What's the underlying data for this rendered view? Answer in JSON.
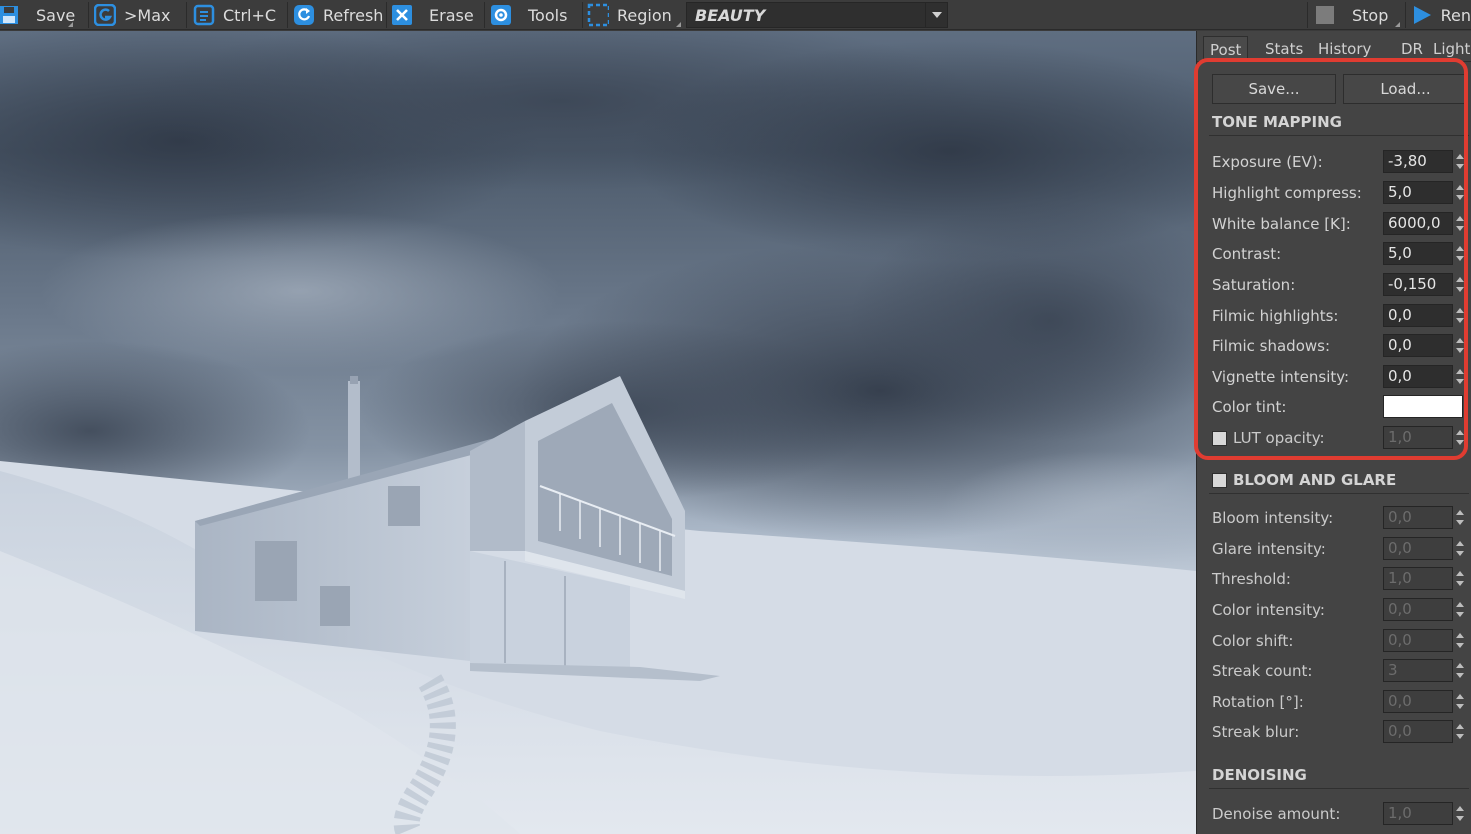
{
  "toolbar": {
    "save_label": "Save",
    "max_label": ">Max",
    "copy_label": "Ctrl+C",
    "refresh_label": "Refresh",
    "erase_label": "Erase",
    "tools_label": "Tools",
    "region_label": "Region",
    "channel_value": "BEAUTY",
    "stop_label": "Stop",
    "render_label": "Ren"
  },
  "panel": {
    "tabs": [
      "Post",
      "Stats",
      "History",
      "DR",
      "Light"
    ],
    "active_tab": "Post",
    "save_button": "Save...",
    "load_button": "Load...",
    "tone_mapping": {
      "title": "TONE MAPPING",
      "rows": [
        {
          "label": "Exposure (EV):",
          "value": "-3,80"
        },
        {
          "label": "Highlight compress:",
          "value": "5,0"
        },
        {
          "label": "White balance [K]:",
          "value": "6000,0"
        },
        {
          "label": "Contrast:",
          "value": "5,0"
        },
        {
          "label": "Saturation:",
          "value": "-0,150"
        },
        {
          "label": "Filmic highlights:",
          "value": "0,0"
        },
        {
          "label": "Filmic shadows:",
          "value": "0,0"
        },
        {
          "label": "Vignette intensity:",
          "value": "0,0"
        }
      ],
      "color_tint_label": "Color tint:",
      "color_tint_value": "#ffffff",
      "lut_label": "LUT opacity:",
      "lut_value": "1,0"
    },
    "bloom": {
      "title": "BLOOM AND GLARE",
      "rows": [
        {
          "label": "Bloom intensity:",
          "value": "0,0"
        },
        {
          "label": "Glare intensity:",
          "value": "0,0"
        },
        {
          "label": "Threshold:",
          "value": "1,0"
        },
        {
          "label": "Color intensity:",
          "value": "0,0"
        },
        {
          "label": "Color shift:",
          "value": "0,0"
        },
        {
          "label": "Streak count:",
          "value": "3"
        },
        {
          "label": "Rotation [°]:",
          "value": "0,0"
        },
        {
          "label": "Streak blur:",
          "value": "0,0"
        }
      ]
    },
    "denoising": {
      "title": "DENOISING",
      "amount_label": "Denoise amount:",
      "amount_value": "1,0"
    }
  },
  "colors": {
    "accent_blue": "#2d8fe0",
    "highlight_red": "#e03c31"
  }
}
